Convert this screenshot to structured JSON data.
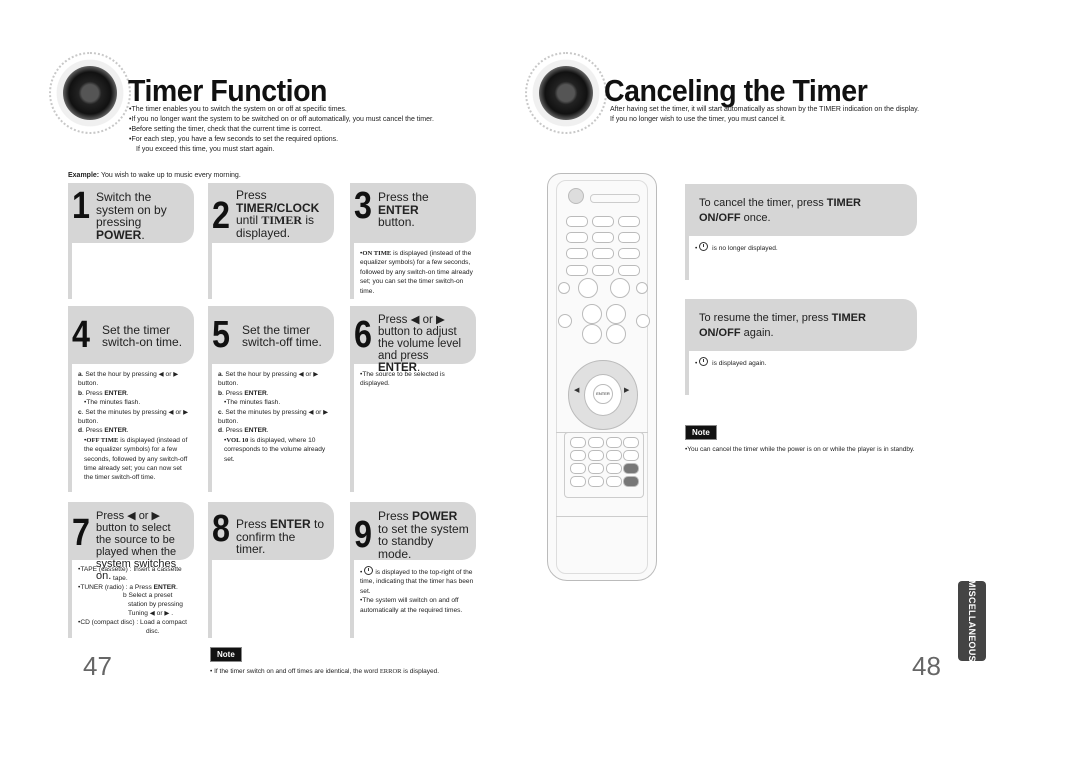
{
  "left_page": {
    "title": "Timer Function",
    "intro": [
      "The timer enables you to switch the system on or off at specific times.",
      "If you no longer want the system to be switched on or off automatically, you must cancel the timer.",
      "Before setting the timer, check that the current time is correct.",
      "For each step, you have a few seconds to set the required options."
    ],
    "intro_continuation": "If you exceed this time, you must start again.",
    "example_label": "Example:",
    "example_text": "You wish to wake up to music every morning.",
    "steps": [
      {
        "num": "1",
        "title_parts": [
          "Switch the system on by pressing ",
          "POWER",
          "."
        ]
      },
      {
        "num": "2",
        "title_parts": [
          "Press ",
          "TIMER/CLOCK",
          " until ",
          "TIMER",
          " is displayed."
        ]
      },
      {
        "num": "3",
        "title_parts": [
          "Press the ",
          "ENTER",
          " button."
        ],
        "body": [
          "ON TIME",
          " is displayed (instead of the equalizer symbols) for a few seconds, followed by any switch-on time already set; you can set the timer switch-on time."
        ]
      },
      {
        "num": "4",
        "title": "Set the timer switch-on time.",
        "body": {
          "a": "Set the hour by pressing ◀ or ▶ button.",
          "b_label": "Press ",
          "b_bold": "ENTER",
          "b_end": ".",
          "b_sub": "The minutes flash.",
          "c": "Set the minutes by pressing ◀ or ▶ button.",
          "d_label": "Press ",
          "d_bold": "ENTER",
          "d_end": ".",
          "d_sub_bold": "OFF TIME",
          "d_sub": " is displayed (instead of the equalizer symbols) for a few seconds, followed by any switch-off time already set; you can now set the timer switch-off time."
        }
      },
      {
        "num": "5",
        "title": "Set the timer switch-off time.",
        "body": {
          "a": "Set the hour by pressing ◀ or ▶ button.",
          "b_label": "Press ",
          "b_bold": "ENTER",
          "b_end": ".",
          "b_sub": "The minutes flash.",
          "c": "Set the minutes by pressing ◀ or ▶ button.",
          "d_label": "Press ",
          "d_bold": "ENTER",
          "d_end": ".",
          "d_sub_bold": "VOL 10",
          "d_sub": " is displayed, where 10 corresponds to the volume already set."
        }
      },
      {
        "num": "6",
        "title_parts": [
          "Press ◀ or ▶ button to adjust the volume level and press ",
          "ENTER",
          "."
        ],
        "body": "The source to be selected is displayed."
      },
      {
        "num": "7",
        "title": "Press ◀ or ▶ button to select the source to be played when the system switches on.",
        "body": {
          "tape": "TAPE (cassette) : Insert a cassette",
          "tape2": "tape.",
          "tuner": "TUNER (radio) : a Press ",
          "tuner_bold": "ENTER",
          "tuner_b1": "b Select a preset",
          "tuner_b2": "station by pressing",
          "tuner_b3": "Tuning ◀ or ▶ .",
          "cd": "CD (compact disc) : Load a compact",
          "cd2": "disc."
        }
      },
      {
        "num": "8",
        "title_parts": [
          "Press ",
          "ENTER",
          " to confirm the timer."
        ]
      },
      {
        "num": "9",
        "title_parts": [
          "Press ",
          "POWER",
          " to set the system to standby mode."
        ],
        "body": [
          "is displayed to the top-right of the time, indicating that the timer has been set.",
          "The system will switch on and off automatically at the required times."
        ]
      }
    ],
    "note_label": "Note",
    "note_text_pre": "If the timer switch on and off times are identical, the word ",
    "note_text_bold": "ERROR",
    "note_text_post": " is displayed.",
    "page_number": "47"
  },
  "right_page": {
    "title": "Canceling the Timer",
    "intro": [
      "After having set the timer, it will start automatically as shown by the TIMER indication on the display.",
      "If you no longer wish to use the timer, you must cancel it."
    ],
    "boxes": [
      {
        "pre": "To cancel the timer, press ",
        "bold": "TIMER ON/OFF",
        "post": " once.",
        "bullet": "is no longer displayed."
      },
      {
        "pre": "To resume the timer, press ",
        "bold": "TIMER ON/OFF",
        "post": " again.",
        "bullet": "is displayed again."
      }
    ],
    "note_label": "Note",
    "note_text": "You can cancel the timer while the power is on or while the player is in standby.",
    "page_number": "48",
    "section_tab": "MISCELLANEOUS"
  },
  "remote": {
    "enter_label": "ENTER"
  }
}
